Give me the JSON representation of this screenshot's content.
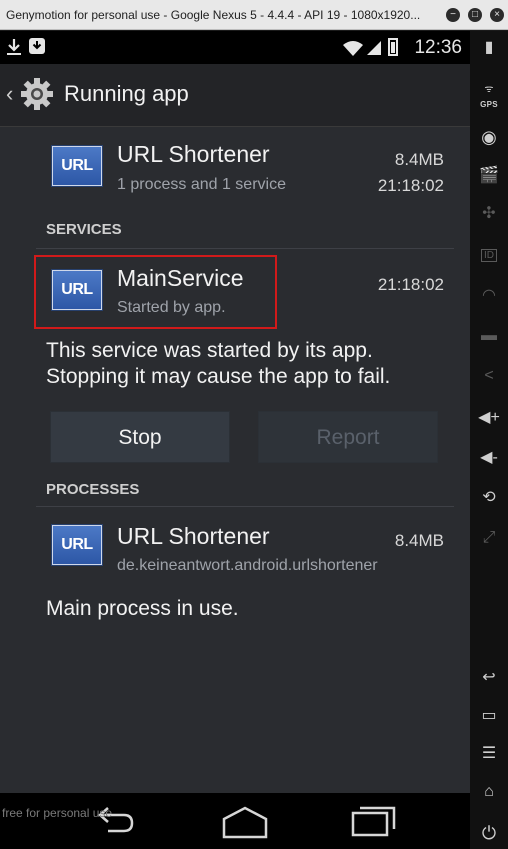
{
  "window": {
    "title": "Genymotion for personal use - Google Nexus 5 - 4.4.4 - API 19 - 1080x1920...",
    "buttons": [
      "−",
      "□",
      "×"
    ]
  },
  "statusbar": {
    "time": "12:36",
    "icons": [
      "download-icon",
      "notification-icon",
      "wifi-icon",
      "signal-icon",
      "battery-icon"
    ]
  },
  "actionbar": {
    "title": "Running app",
    "icon": "gear-icon"
  },
  "app": {
    "icon_text": "URL",
    "name": "URL Shortener",
    "subtitle": "1 process and 1 service",
    "size": "8.4MB",
    "time": "21:18:02"
  },
  "services": {
    "header": "SERVICES",
    "item": {
      "icon_text": "URL",
      "name": "MainService",
      "subtitle": "Started by app.",
      "time": "21:18:02"
    },
    "description_line1": "This service was started by its app.",
    "description_line2": "Stopping it may cause the app to fail.",
    "stop_label": "Stop",
    "report_label": "Report"
  },
  "processes": {
    "header": "PROCESSES",
    "item": {
      "icon_text": "URL",
      "name": "URL Shortener",
      "subtitle": "de.keineantwort.android.urlshortener",
      "size": "8.4MB"
    },
    "description": "Main process in use."
  },
  "watermark": "free for personal use",
  "toolbar": {
    "gps_label": "GPS",
    "id_label": "ID",
    "items": [
      "battery-icon",
      "gps-icon",
      "camera-icon",
      "clapper-icon",
      "dpad-icon",
      "id-icon",
      "rss-icon",
      "sms-icon",
      "share-icon",
      "volume-up-icon",
      "volume-down-icon",
      "rotate-icon",
      "scale-icon",
      "back-icon",
      "recent-apps-icon",
      "menu-icon",
      "home-icon",
      "power-icon"
    ]
  },
  "colors": {
    "highlight": "#d11a1a",
    "icon_blue": "#3d68b8",
    "background": "#2a2c30"
  }
}
